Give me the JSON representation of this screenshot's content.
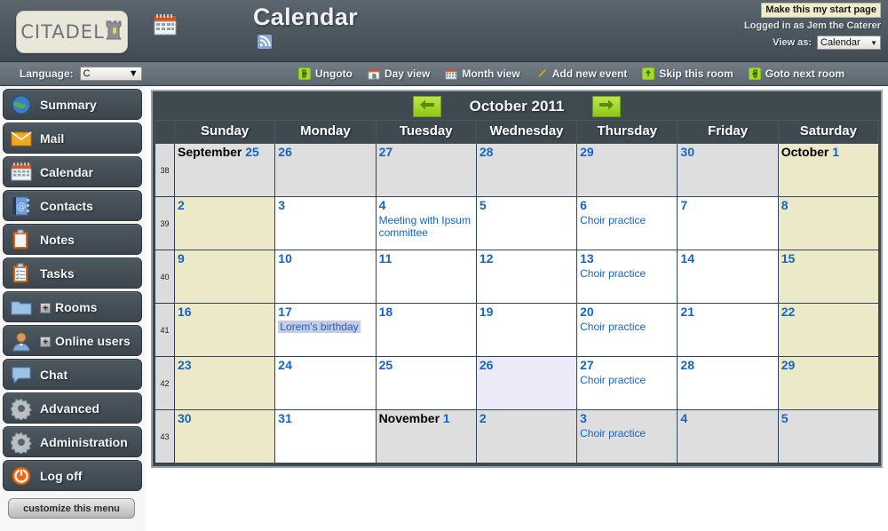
{
  "banner": {
    "logo_text": "CITADEL",
    "logo_icon": "rook-tower-icon",
    "room_icon": "calendar-icon",
    "room_title": "Calendar",
    "rss_icon": "rss-feed-icon",
    "start_page_button": "Make this my start page",
    "logged_in_text": "Logged in as Jem the Caterer",
    "view_as_label": "View as:",
    "view_as_value": "Calendar"
  },
  "toolbar": {
    "language_label": "Language:",
    "language_value": "C",
    "actions": [
      {
        "label": "Ungoto",
        "icon": "ungoto-icon"
      },
      {
        "label": "Day view",
        "icon": "day-view-icon"
      },
      {
        "label": "Month view",
        "icon": "month-view-icon"
      },
      {
        "label": "Add new event",
        "icon": "pencil-icon"
      },
      {
        "label": "Skip this room",
        "icon": "skip-room-icon"
      },
      {
        "label": "Goto next room",
        "icon": "goto-next-room-icon"
      }
    ]
  },
  "sidebar": {
    "items": [
      {
        "label": "Summary",
        "icon": "globe-icon",
        "expandable": false
      },
      {
        "label": "Mail",
        "icon": "envelope-icon",
        "expandable": false
      },
      {
        "label": "Calendar",
        "icon": "calendar-icon",
        "expandable": false
      },
      {
        "label": "Contacts",
        "icon": "address-book-icon",
        "expandable": false
      },
      {
        "label": "Notes",
        "icon": "clipboard-icon",
        "expandable": false
      },
      {
        "label": "Tasks",
        "icon": "checklist-icon",
        "expandable": false
      },
      {
        "label": "Rooms",
        "icon": "folder-icon",
        "expandable": true
      },
      {
        "label": "Online users",
        "icon": "user-icon",
        "expandable": true
      },
      {
        "label": "Chat",
        "icon": "chat-bubble-icon",
        "expandable": false
      },
      {
        "label": "Advanced",
        "icon": "gear-icon",
        "expandable": false
      },
      {
        "label": "Administration",
        "icon": "gear-icon",
        "expandable": false
      },
      {
        "label": "Log off",
        "icon": "power-icon",
        "expandable": false
      }
    ],
    "customize_button": "customize this menu"
  },
  "calendar": {
    "prev_icon": "arrow-left-icon",
    "next_icon": "arrow-right-icon",
    "month_title": "October 2011",
    "day_headers": [
      "Sunday",
      "Monday",
      "Tuesday",
      "Wednesday",
      "Thursday",
      "Friday",
      "Saturday"
    ],
    "weeks": [
      {
        "number": "38",
        "days": [
          {
            "month": "September",
            "num": "25",
            "state": "out",
            "events": []
          },
          {
            "month": "",
            "num": "26",
            "state": "out",
            "events": []
          },
          {
            "month": "",
            "num": "27",
            "state": "out",
            "events": []
          },
          {
            "month": "",
            "num": "28",
            "state": "out",
            "events": []
          },
          {
            "month": "",
            "num": "29",
            "state": "out",
            "events": []
          },
          {
            "month": "",
            "num": "30",
            "state": "out",
            "events": []
          },
          {
            "month": "October",
            "num": "1",
            "state": "weekend",
            "events": []
          }
        ]
      },
      {
        "number": "39",
        "days": [
          {
            "month": "",
            "num": "2",
            "state": "weekend",
            "events": []
          },
          {
            "month": "",
            "num": "3",
            "state": "normal",
            "events": []
          },
          {
            "month": "",
            "num": "4",
            "state": "normal",
            "events": [
              {
                "text": "Meeting with Ipsum committee",
                "allday": false
              }
            ]
          },
          {
            "month": "",
            "num": "5",
            "state": "normal",
            "events": []
          },
          {
            "month": "",
            "num": "6",
            "state": "normal",
            "events": [
              {
                "text": "Choir practice",
                "allday": false
              }
            ]
          },
          {
            "month": "",
            "num": "7",
            "state": "normal",
            "events": []
          },
          {
            "month": "",
            "num": "8",
            "state": "weekend",
            "events": []
          }
        ]
      },
      {
        "number": "40",
        "days": [
          {
            "month": "",
            "num": "9",
            "state": "weekend",
            "events": []
          },
          {
            "month": "",
            "num": "10",
            "state": "normal",
            "events": []
          },
          {
            "month": "",
            "num": "11",
            "state": "normal",
            "events": []
          },
          {
            "month": "",
            "num": "12",
            "state": "normal",
            "events": []
          },
          {
            "month": "",
            "num": "13",
            "state": "normal",
            "events": [
              {
                "text": "Choir practice",
                "allday": false
              }
            ]
          },
          {
            "month": "",
            "num": "14",
            "state": "normal",
            "events": []
          },
          {
            "month": "",
            "num": "15",
            "state": "weekend",
            "events": []
          }
        ]
      },
      {
        "number": "41",
        "days": [
          {
            "month": "",
            "num": "16",
            "state": "weekend",
            "events": []
          },
          {
            "month": "",
            "num": "17",
            "state": "normal",
            "events": [
              {
                "text": "Lorem's birthday",
                "allday": true
              }
            ]
          },
          {
            "month": "",
            "num": "18",
            "state": "normal",
            "events": []
          },
          {
            "month": "",
            "num": "19",
            "state": "normal",
            "events": []
          },
          {
            "month": "",
            "num": "20",
            "state": "normal",
            "events": [
              {
                "text": "Choir practice",
                "allday": false
              }
            ]
          },
          {
            "month": "",
            "num": "21",
            "state": "normal",
            "events": []
          },
          {
            "month": "",
            "num": "22",
            "state": "weekend",
            "events": []
          }
        ]
      },
      {
        "number": "42",
        "days": [
          {
            "month": "",
            "num": "23",
            "state": "weekend",
            "events": []
          },
          {
            "month": "",
            "num": "24",
            "state": "normal",
            "events": []
          },
          {
            "month": "",
            "num": "25",
            "state": "normal",
            "events": []
          },
          {
            "month": "",
            "num": "26",
            "state": "today",
            "events": []
          },
          {
            "month": "",
            "num": "27",
            "state": "normal",
            "events": [
              {
                "text": "Choir practice",
                "allday": false
              }
            ]
          },
          {
            "month": "",
            "num": "28",
            "state": "normal",
            "events": []
          },
          {
            "month": "",
            "num": "29",
            "state": "weekend",
            "events": []
          }
        ]
      },
      {
        "number": "43",
        "days": [
          {
            "month": "",
            "num": "30",
            "state": "weekend",
            "events": []
          },
          {
            "month": "",
            "num": "31",
            "state": "normal",
            "events": []
          },
          {
            "month": "November",
            "num": "1",
            "state": "out",
            "events": []
          },
          {
            "month": "",
            "num": "2",
            "state": "out",
            "events": []
          },
          {
            "month": "",
            "num": "3",
            "state": "out",
            "events": [
              {
                "text": "Choir practice",
                "allday": false
              }
            ]
          },
          {
            "month": "",
            "num": "4",
            "state": "out",
            "events": []
          },
          {
            "month": "",
            "num": "5",
            "state": "out",
            "events": []
          }
        ]
      }
    ]
  },
  "colors": {
    "accent_green": "#a6d72e",
    "link_blue": "#1464c8",
    "weekend_bg": "#ebe9c8",
    "today_bg": "#eceaf8",
    "outmonth_bg": "#dedede",
    "allday_bg": "#c9cbe0"
  }
}
